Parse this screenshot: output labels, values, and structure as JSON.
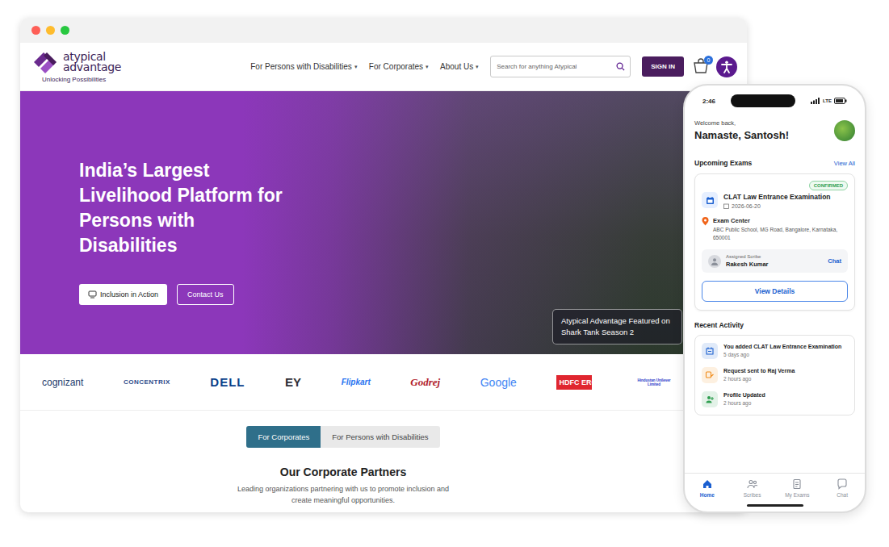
{
  "browser": {
    "header": {
      "logo": {
        "line1": "atypical",
        "line2": "advantage",
        "tagline": "Unlocking Possibilities"
      },
      "nav": [
        {
          "label": "For Persons with Disabilities",
          "caret": "▾"
        },
        {
          "label": "For Corporates",
          "caret": "▾"
        },
        {
          "label": "About Us",
          "caret": "▾"
        }
      ],
      "search": {
        "placeholder": "Search for anything Atypical"
      },
      "sign_in": "SIGN IN",
      "cart_count": "0"
    },
    "hero": {
      "title": "India’s Largest Livelihood Platform for Persons with Disabilities",
      "buttons": [
        {
          "label": "Inclusion in Action",
          "kind": "filled"
        },
        {
          "label": "Contact Us",
          "kind": "outline"
        }
      ],
      "caption": "Atypical Advantage Featured on Shark Tank Season 2"
    },
    "partners": [
      {
        "text": "cognizant",
        "color": "#1a3a6b"
      },
      {
        "text": "CONCENTRIX",
        "color": "#2c4a8a"
      },
      {
        "text": "DELL",
        "color": "#0a3f8a"
      },
      {
        "text": "EY",
        "color": "#2e2e38"
      },
      {
        "text": "Flipkart",
        "color": "#2874f0"
      },
      {
        "text": "Godrej",
        "color": "#b0202a"
      },
      {
        "text": "Google",
        "color": "#4285f4"
      },
      {
        "text": "HDFC ERGO",
        "color": "#e0262f"
      },
      {
        "text": "Hindustan Unilever Limited",
        "color": "#1f36c7"
      }
    ],
    "section": {
      "tabs": [
        {
          "label": "For Corporates",
          "selected": true
        },
        {
          "label": "For Persons with Disabilities",
          "selected": false
        }
      ],
      "heading": "Our Corporate Partners",
      "subtitle": "Leading organizations partnering with us to promote inclusion and create meaningful opportunities."
    }
  },
  "phone": {
    "status": {
      "time": "2:46",
      "network": "LTE"
    },
    "welcome": "Welcome back,",
    "name": "Namaste, Santosh!",
    "upcoming": {
      "title": "Upcoming Exams",
      "view_all": "View All",
      "exam": {
        "status": "CONFIRMED",
        "title": "CLAT Law Entrance Examination",
        "date": "2026-06-20",
        "center_label": "Exam Center",
        "address": "ABC Public School, MG Road, Bangalore, Karnataka, 650001",
        "scribe_label": "Assigned Scribe",
        "scribe_name": "Rakesh Kumar",
        "chat": "Chat",
        "button": "View Details"
      }
    },
    "activity": {
      "title": "Recent Activity",
      "items": [
        {
          "text": "You added CLAT Law Entrance Examination",
          "time": "5 days ago",
          "color": "#1a5fd0"
        },
        {
          "text": "Request sent to Raj Verma",
          "time": "2 hours ago",
          "color": "#f08c1a"
        },
        {
          "text": "Profile Updated",
          "time": "2 hours ago",
          "color": "#2e9e4f"
        }
      ]
    },
    "bottom_nav": [
      {
        "label": "Home",
        "selected": true
      },
      {
        "label": "Scribes",
        "selected": false
      },
      {
        "label": "My Exams",
        "selected": false
      },
      {
        "label": "Chat",
        "selected": false
      }
    ]
  }
}
